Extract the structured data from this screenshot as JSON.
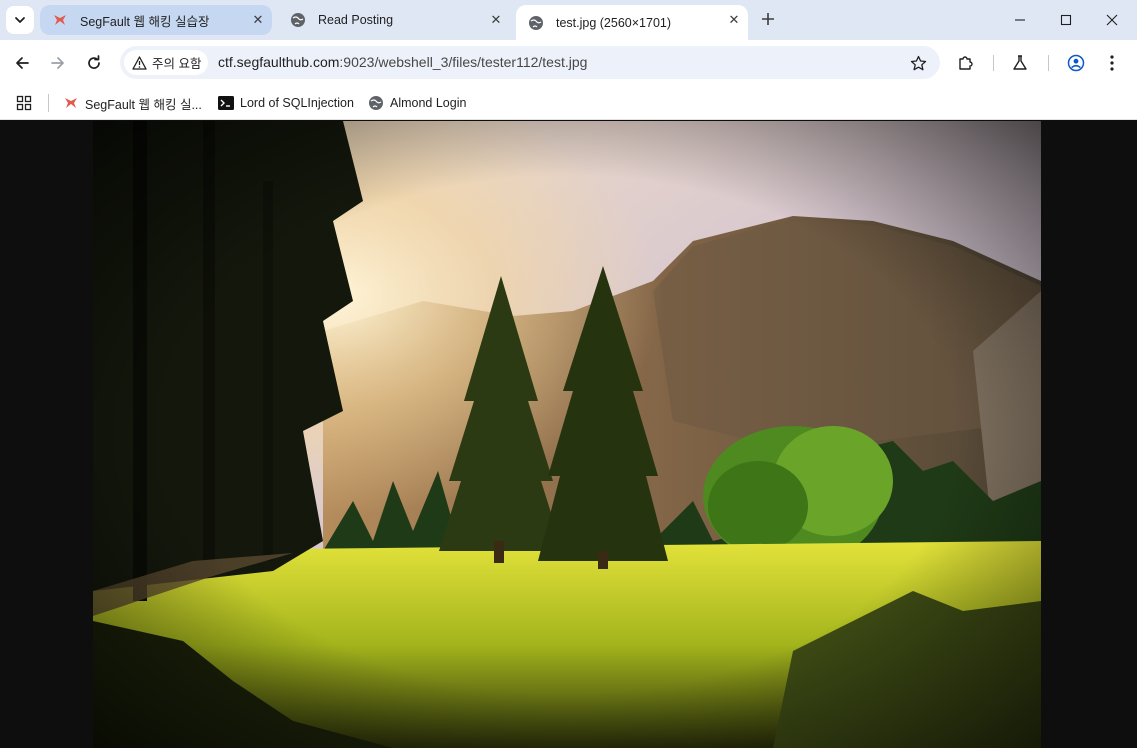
{
  "tabs": [
    {
      "title": "SegFault 웹 해킹 실습장",
      "favicon": "segfault-logo-icon",
      "active": false
    },
    {
      "title": "Read Posting",
      "favicon": "globe-icon",
      "active": false
    },
    {
      "title": "test.jpg (2560×1701)",
      "favicon": "globe-icon",
      "active": true
    }
  ],
  "toolbar": {
    "security_label": "주의 요함",
    "url_host": "ctf.segfaulthub.com",
    "url_path": ":9023/webshell_3/files/tester112/test.jpg"
  },
  "bookmarks": [
    {
      "label": "SegFault 웹 해킹 실...",
      "icon": "segfault-logo-icon"
    },
    {
      "label": "Lord of SQLInjection",
      "icon": "terminal-icon"
    },
    {
      "label": "Almond Login",
      "icon": "globe-icon"
    }
  ],
  "image": {
    "subject": "forest-meadow-mountain-sunset-icon"
  },
  "colors": {
    "tabstrip": "#dfe7f5",
    "active_tab": "#ffffff",
    "highlight_tab": "#c6d7f2",
    "omnibox": "#edf2fa",
    "viewer_bg": "#0e0e0e"
  }
}
